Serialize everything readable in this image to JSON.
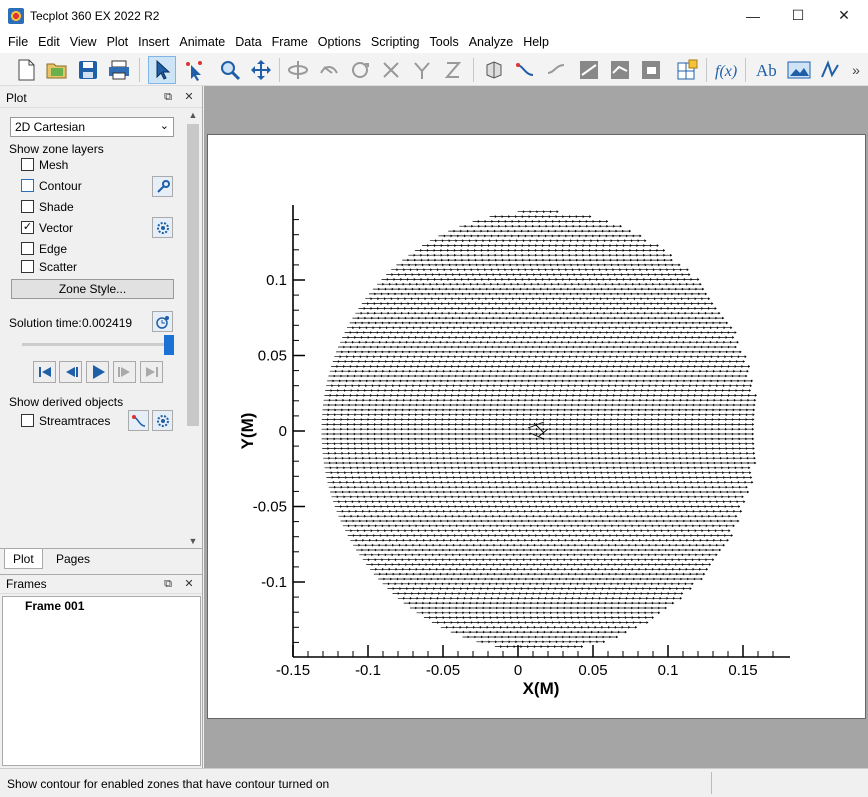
{
  "window": {
    "title": "Tecplot 360 EX 2022 R2",
    "minimize": "—",
    "maximize": "☐",
    "close": "✕"
  },
  "menu": [
    "File",
    "Edit",
    "View",
    "Plot",
    "Insert",
    "Animate",
    "Data",
    "Frame",
    "Options",
    "Scripting",
    "Tools",
    "Analyze",
    "Help"
  ],
  "toolbar": {
    "overflow": "»"
  },
  "plot_panel": {
    "title": "Plot",
    "plot_type": "2D Cartesian",
    "show_zone_layers": "Show zone layers",
    "layers": [
      {
        "label": "Mesh",
        "checked": false
      },
      {
        "label": "Contour",
        "checked": false
      },
      {
        "label": "Shade",
        "checked": false
      },
      {
        "label": "Vector",
        "checked": true
      },
      {
        "label": "Edge",
        "checked": false
      },
      {
        "label": "Scatter",
        "checked": false
      }
    ],
    "zone_style": "Zone Style...",
    "solution_time_label": "Solution time:",
    "solution_time_value": "0.002419",
    "show_derived_objects": "Show derived objects",
    "streamtraces": "Streamtraces",
    "streamtraces_checked": false
  },
  "tabs": {
    "plot": "Plot",
    "pages": "Pages"
  },
  "frames_panel": {
    "title": "Frames",
    "items": [
      "Frame 001"
    ]
  },
  "status": "Show contour for enabled zones that have contour turned on",
  "chart_data": {
    "type": "vector",
    "xlabel": "X(M)",
    "ylabel": "Y(M)",
    "xlim": [
      -0.15,
      0.18
    ],
    "ylim": [
      -0.15,
      0.15
    ],
    "xticks": [
      "-0.15",
      "-0.1",
      "-0.05",
      "0",
      "0.05",
      "0.1",
      "0.15"
    ],
    "yticks": [
      "0.1",
      "0.05",
      "0",
      "-0.05",
      "-0.1"
    ],
    "domain_center": [
      0.015,
      0.0
    ],
    "domain_radius": 0.146,
    "flow_direction": "+x"
  }
}
